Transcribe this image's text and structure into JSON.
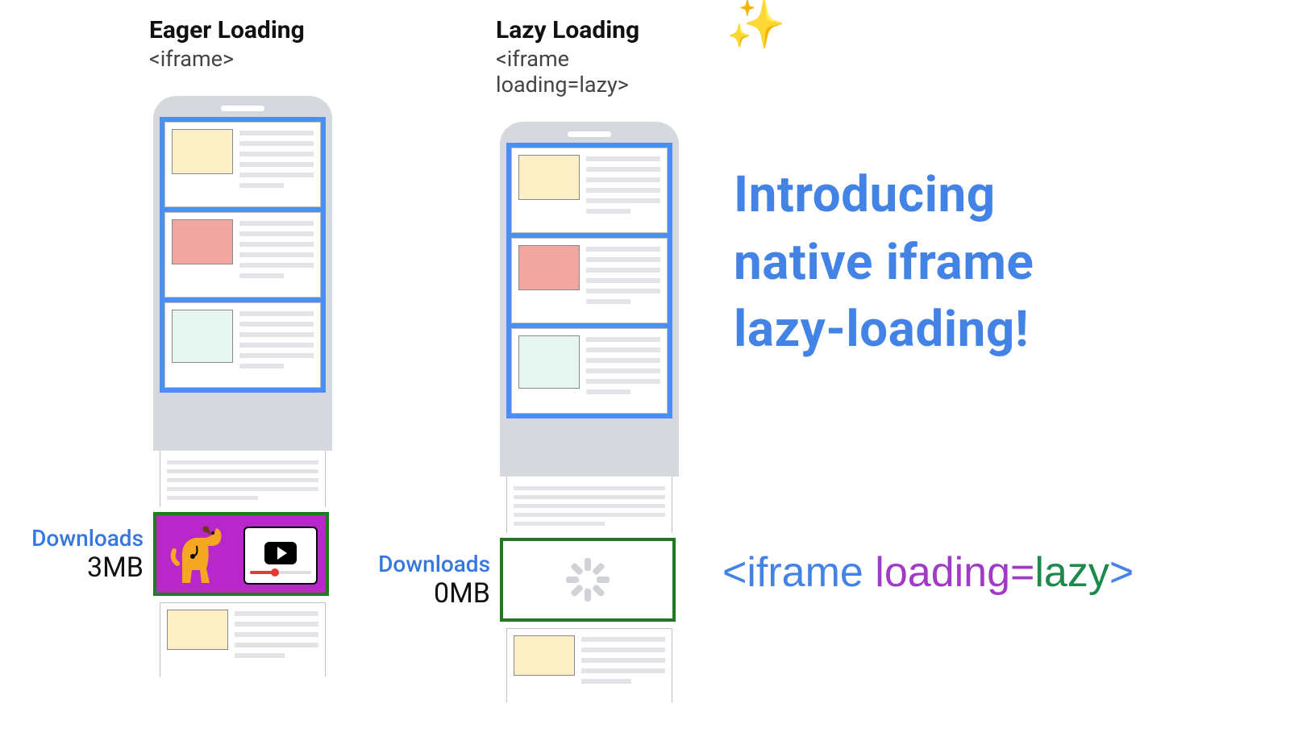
{
  "cols": [
    {
      "title": "Eager Loading",
      "sub": "<iframe>",
      "downloads_label": "Downloads",
      "downloads_value": "3MB",
      "iframe_state": "loaded"
    },
    {
      "title": "Lazy Loading",
      "sub": "<iframe loading=lazy>",
      "downloads_label": "Downloads",
      "downloads_value": "0MB",
      "iframe_state": "lazy"
    }
  ],
  "headline_lines": [
    "Introducing",
    "native iframe",
    "lazy-loading!"
  ],
  "code": {
    "open": "<iframe ",
    "attr": "loading=",
    "val": "lazy",
    "close": ">"
  },
  "sparkles": "✨"
}
